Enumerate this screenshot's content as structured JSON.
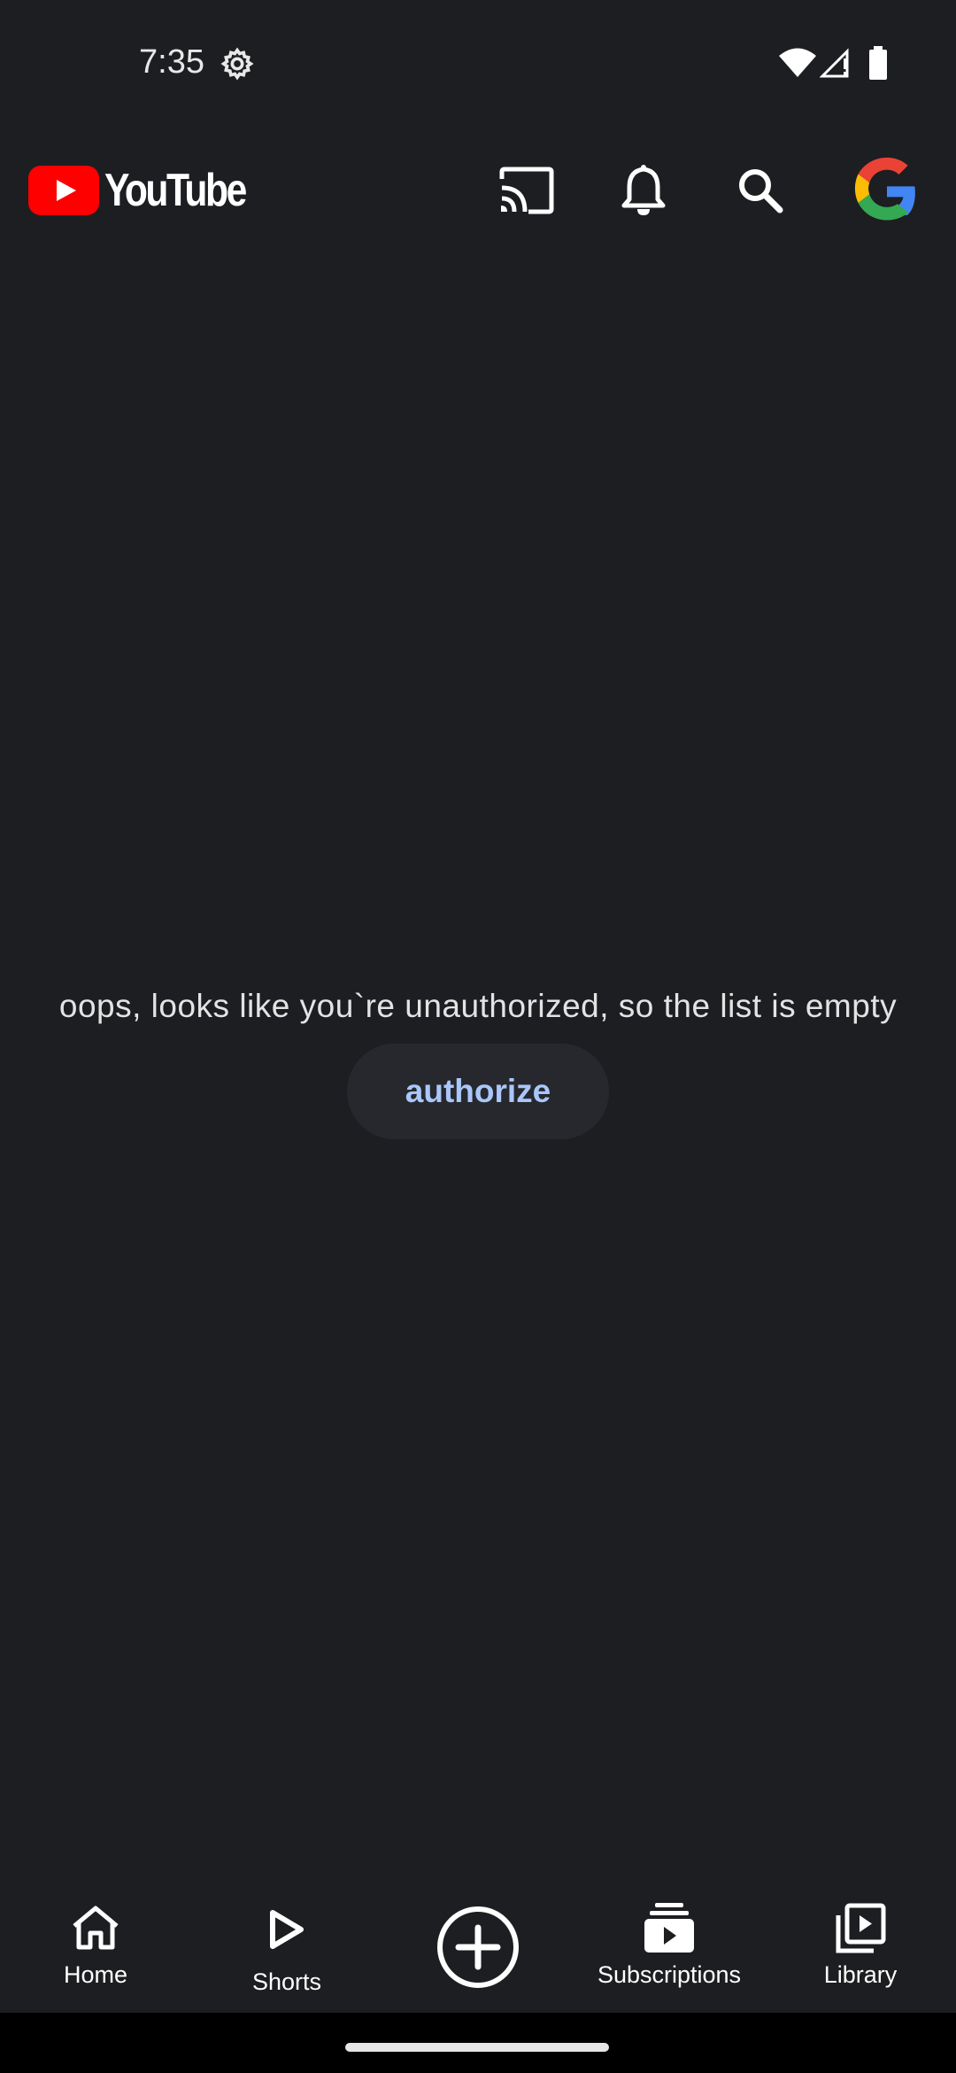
{
  "status_bar": {
    "time": "7:35",
    "icons": [
      "settings-gear-icon",
      "wifi-icon",
      "cellular-signal-icon",
      "battery-icon"
    ]
  },
  "header": {
    "brand": "YouTube",
    "brand_color": "#ff0000",
    "actions": [
      "cast-icon",
      "notifications-bell-icon",
      "search-icon",
      "google-account-icon"
    ]
  },
  "main": {
    "empty_message": "oops, looks like you`re unauthorized, so the list is empty",
    "authorize_label": "authorize",
    "authorize_color": "#a9c7fa"
  },
  "bottom_nav": {
    "items": [
      {
        "label": "Home",
        "icon": "home-icon"
      },
      {
        "label": "Shorts",
        "icon": "shorts-play-icon"
      },
      {
        "label": "",
        "icon": "create-plus-icon"
      },
      {
        "label": "Subscriptions",
        "icon": "subscriptions-icon"
      },
      {
        "label": "Library",
        "icon": "library-icon"
      }
    ]
  },
  "colors": {
    "background": "#1d1e21",
    "text": "#ffffff",
    "button_bg": "#27282d"
  }
}
